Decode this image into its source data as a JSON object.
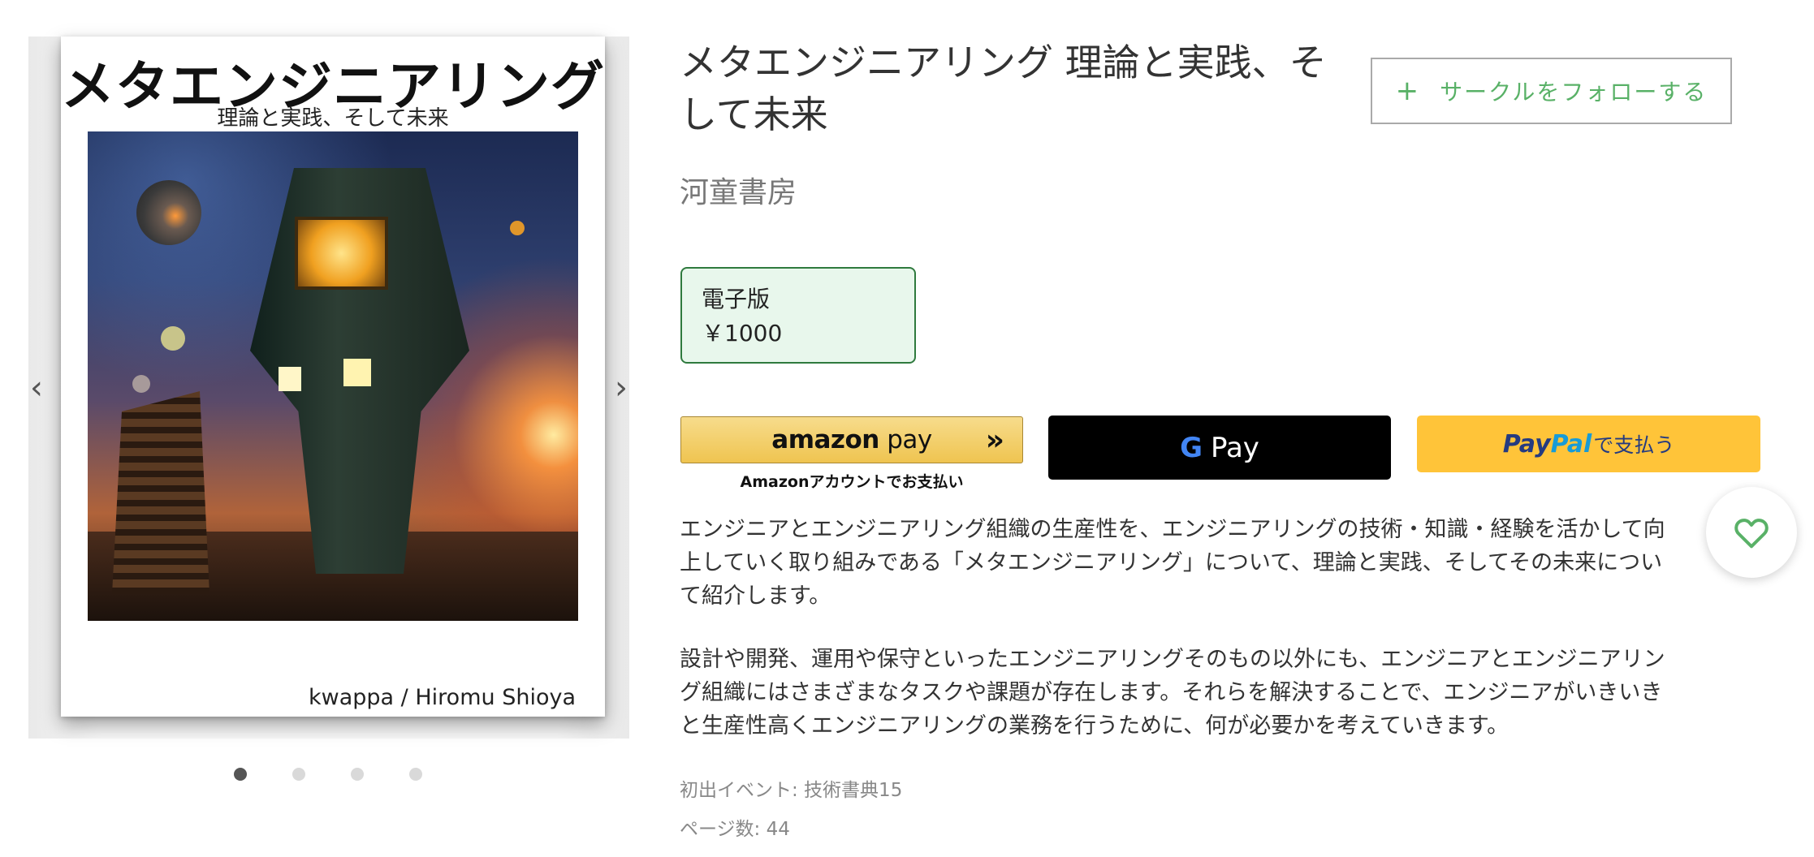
{
  "gallery": {
    "cover_title": "メタエンジニアリング",
    "cover_subtitle": "理論と実践、そして未来",
    "cover_author": "kwappa / Hiromu Shioya",
    "prev_arrow": "‹",
    "next_arrow": "›",
    "dot_count": 4,
    "active_dot": 1
  },
  "book": {
    "title": "メタエンジニアリング 理論と実践、そして未来",
    "circle_name": "河童書房"
  },
  "follow_button": {
    "plus": "+",
    "label": "サークルをフォローする"
  },
  "edition": {
    "label": "電子版",
    "price": "￥1000"
  },
  "payment": {
    "amazon_brand": "amazon",
    "amazon_pay": " pay",
    "amazon_chevron": "»",
    "amazon_sub": "Amazonアカウントでお支払い",
    "gpay_g": "G",
    "gpay_pay": "Pay",
    "paypal_pay": "Pay",
    "paypal_pal": "Pal",
    "paypal_text": "で支払う"
  },
  "description": {
    "paragraph_1": "エンジニアとエンジニアリング組織の生産性を、エンジニアリングの技術・知識・経験を活かして向上していく取り組みである「メタエンジニアリング」について、理論と実践、そしてその未来について紹介します。",
    "paragraph_2": "設計や開発、運用や保守といったエンジニアリングそのもの以外にも、エンジニアとエンジニアリング組織にはさまざまなタスクや課題が存在します。それらを解決することで、エンジニアがいきいきと生産性高くエンジニアリングの業務を行うために、何が必要かを考えていきます。"
  },
  "meta": {
    "first_event": "初出イベント: 技術書典15",
    "pages": "ページ数: 44"
  },
  "colors": {
    "accent_green": "#59b167",
    "edition_bg": "#e8f7ec",
    "edition_border": "#2f7a3e",
    "amazon_yellow": "#efc450",
    "paypal_yellow": "#ffc439",
    "paypal_blue_dark": "#253b80",
    "paypal_blue_light": "#179bd7"
  },
  "icons": {
    "wishlist": "heart-outline-icon",
    "follow": "plus-icon",
    "prev": "chevron-left-icon",
    "next": "chevron-right-icon"
  }
}
